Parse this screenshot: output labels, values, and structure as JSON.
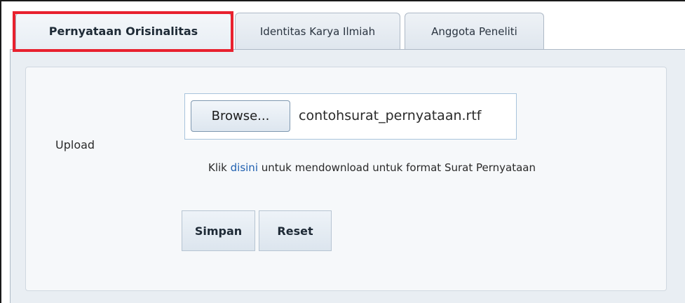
{
  "tabs": [
    {
      "label": "Pernyataan Orisinalitas",
      "active": true
    },
    {
      "label": "Identitas Karya Ilmiah",
      "active": false
    },
    {
      "label": "Anggota Peneliti",
      "active": false
    }
  ],
  "form": {
    "upload_label": "Upload",
    "browse_label": "Browse...",
    "file_name": "contohsurat_pernyataan.rtf",
    "hint_prefix": "Klik ",
    "hint_link": "disini",
    "hint_suffix": " untuk mendownload untuk format Surat Pernyataan"
  },
  "buttons": {
    "save_label": "Simpan",
    "reset_label": "Reset"
  },
  "colors": {
    "highlight": "#e8212e",
    "link": "#2060b0",
    "panel_bg": "#e9eef3"
  }
}
